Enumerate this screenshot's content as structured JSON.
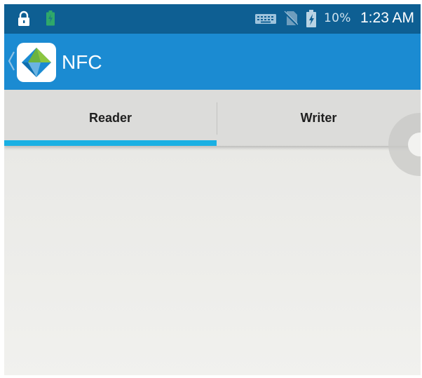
{
  "status_bar": {
    "battery_percent": "10%",
    "time": "1:23 AM",
    "icons": [
      "lock-icon",
      "battery-charging-icon",
      "keyboard-icon",
      "no-sim-icon",
      "battery-icon"
    ]
  },
  "action_bar": {
    "title": "NFC",
    "icons": [
      "back-chevron-icon",
      "app-logo-icon"
    ]
  },
  "tabs": [
    {
      "label": "Reader",
      "selected": true
    },
    {
      "label": "Writer",
      "selected": false
    }
  ],
  "colors": {
    "status_bar_bg": "#0e5f93",
    "action_bar_bg": "#1b8bd2",
    "tab_indicator": "#1ab0e3",
    "tab_bar_bg": "#dcdcda",
    "content_bg": "#ebebe8"
  }
}
